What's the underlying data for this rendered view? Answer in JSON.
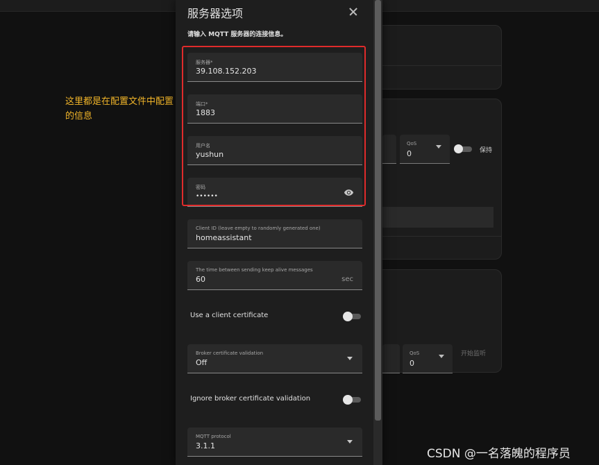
{
  "annotation": {
    "text": "这里都是在配置文件中配置的信息"
  },
  "background": {
    "qos1": {
      "label": "QoS",
      "value": "0"
    },
    "retain_label": "保持",
    "qos2": {
      "label": "QoS",
      "value": "0"
    },
    "start_listen_label": "开始监听"
  },
  "dialog": {
    "title": "服务器选项",
    "description": "请输入 MQTT 服务器的连接信息。",
    "fields": {
      "broker": {
        "label": "服务器*",
        "value": "39.108.152.203"
      },
      "port": {
        "label": "端口*",
        "value": "1883"
      },
      "username": {
        "label": "用户名",
        "value": "yushun"
      },
      "password": {
        "label": "密码",
        "value": "••••••"
      },
      "client_id": {
        "label": "Client ID (leave empty to randomly generated one)",
        "value": "homeassistant"
      },
      "keepalive": {
        "label": "The time between sending keep alive messages",
        "value": "60",
        "suffix": "sec"
      },
      "cert_validation": {
        "label": "Broker certificate validation",
        "value": "Off"
      },
      "protocol": {
        "label": "MQTT protocol",
        "value": "3.1.1"
      }
    },
    "toggles": {
      "client_certificate": {
        "label": "Use a client certificate",
        "on": false
      },
      "ignore_validation": {
        "label": "Ignore broker certificate validation",
        "on": false
      }
    },
    "colors": {
      "highlight": "#e02b2b",
      "annotation": "#f0b429"
    }
  },
  "watermark": "CSDN @一名落魄的程序员"
}
